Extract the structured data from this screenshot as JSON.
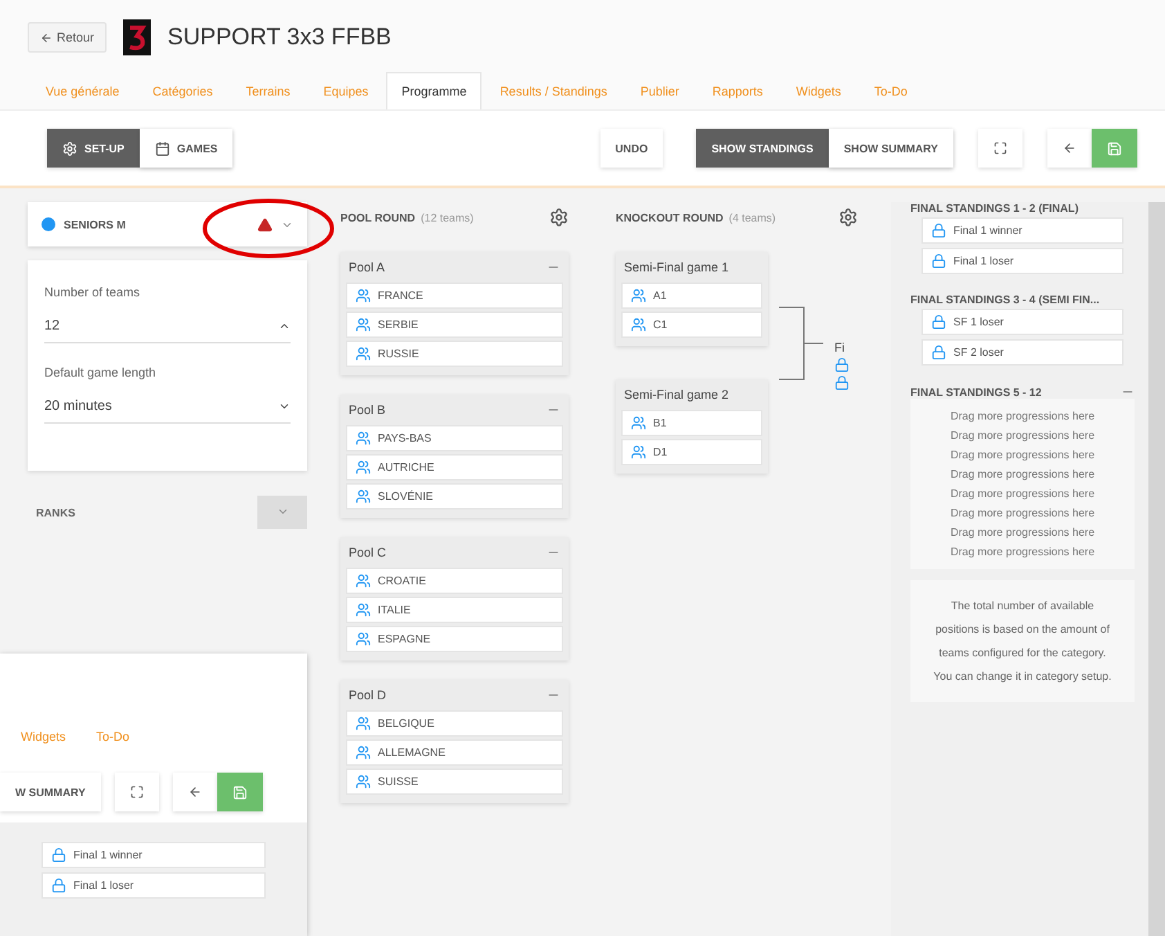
{
  "back_button": "Retour",
  "app_title": "SUPPORT 3x3 FFBB",
  "tabs": [
    {
      "label": "Vue générale",
      "selected": false
    },
    {
      "label": "Catégories",
      "selected": false
    },
    {
      "label": "Terrains",
      "selected": false
    },
    {
      "label": "Equipes",
      "selected": false
    },
    {
      "label": "Programme",
      "selected": true
    },
    {
      "label": "Results / Standings",
      "selected": false
    },
    {
      "label": "Publier",
      "selected": false
    },
    {
      "label": "Rapports",
      "selected": false
    },
    {
      "label": "Widgets",
      "selected": false
    },
    {
      "label": "To-Do",
      "selected": false
    }
  ],
  "toolbar": {
    "view_buttons": [
      {
        "label": "SET-UP",
        "kind": "setup",
        "selected": true
      },
      {
        "label": "GAMES",
        "kind": "games",
        "selected": false
      }
    ],
    "undo": "UNDO",
    "display_buttons": [
      {
        "label": "SHOW STANDINGS",
        "selected": true
      },
      {
        "label": "SHOW SUMMARY",
        "selected": false
      }
    ]
  },
  "category": {
    "name": "SENIORS M",
    "color": "#2196f3",
    "warning": true
  },
  "setup": {
    "fields": [
      {
        "label": "Number of teams",
        "value": "12",
        "kind": "number"
      },
      {
        "label": "Default game length",
        "value": "20 minutes",
        "kind": "select"
      }
    ],
    "ranks_label": "RANKS"
  },
  "pool_round": {
    "title": "POOL ROUND",
    "count": "(12 teams)",
    "pools": [
      {
        "name": "Pool A",
        "teams": [
          "FRANCE",
          "SERBIE",
          "RUSSIE"
        ]
      },
      {
        "name": "Pool B",
        "teams": [
          "PAYS-BAS",
          "AUTRICHE",
          "SLOVÉNIE"
        ]
      },
      {
        "name": "Pool C",
        "teams": [
          "CROATIE",
          "ITALIE",
          "ESPAGNE"
        ]
      },
      {
        "name": "Pool D",
        "teams": [
          "BELGIQUE",
          "ALLEMAGNE",
          "SUISSE"
        ]
      }
    ]
  },
  "knockout_round": {
    "title": "KNOCKOUT ROUND",
    "count": "(4 teams)",
    "games": [
      {
        "name": "Semi-Final game 1",
        "slots": [
          "A1",
          "C1"
        ]
      },
      {
        "name": "Semi-Final game 2",
        "slots": [
          "B1",
          "D1"
        ]
      }
    ],
    "next_column_label": "Fi"
  },
  "standings": {
    "groups": [
      {
        "title": "FINAL STANDINGS 1 - 2 (FINAL)",
        "slots": [
          "Final 1 winner",
          "Final 1 loser"
        ]
      },
      {
        "title": "FINAL STANDINGS 3 - 4 (SEMI FIN...",
        "slots": [
          "SF 1 loser",
          "SF 2 loser"
        ]
      },
      {
        "title": "FINAL STANDINGS 5 - 12",
        "drop_hints": [
          "Drag more progressions here",
          "Drag more progressions here",
          "Drag more progressions here",
          "Drag more progressions here",
          "Drag more progressions here",
          "Drag more progressions here",
          "Drag more progressions here",
          "Drag more progressions here"
        ]
      }
    ],
    "info": "The total number of available positions is based on the amount of teams configured for the category. You can change it in category setup."
  },
  "inset": {
    "tabs": [
      "Widgets",
      "To-Do"
    ],
    "summary_button": "W SUMMARY",
    "slots": [
      "Final 1 winner",
      "Final 1 loser"
    ]
  }
}
